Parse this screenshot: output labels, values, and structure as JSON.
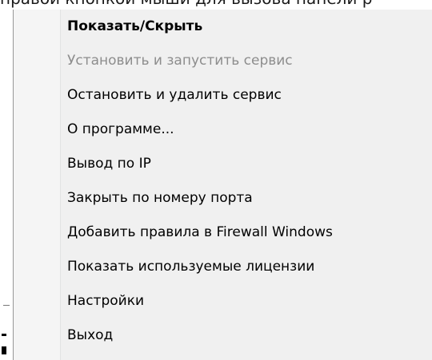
{
  "caption": "правой кнопкой мыши для вызова панели р",
  "menu": {
    "items": [
      {
        "label": "Показать/Скрыть",
        "bold": true,
        "disabled": false
      },
      {
        "label": "Установить и запустить сервис",
        "bold": false,
        "disabled": true
      },
      {
        "label": "Остановить и удалить сервис",
        "bold": false,
        "disabled": false
      },
      {
        "label": "О программе...",
        "bold": false,
        "disabled": false
      },
      {
        "label": "Вывод по IP",
        "bold": false,
        "disabled": false
      },
      {
        "label": "Закрыть по номеру порта",
        "bold": false,
        "disabled": false
      },
      {
        "label": "Добавить правила в Firewall Windows",
        "bold": false,
        "disabled": false
      },
      {
        "label": "Показать используемые лицензии",
        "bold": false,
        "disabled": false
      },
      {
        "label": "Настройки",
        "bold": false,
        "disabled": false
      },
      {
        "label": "Выход",
        "bold": false,
        "disabled": false
      }
    ]
  },
  "colors": {
    "menu_background": "#f0f0f0",
    "text": "#000000",
    "disabled_text": "#8d8d8d"
  }
}
